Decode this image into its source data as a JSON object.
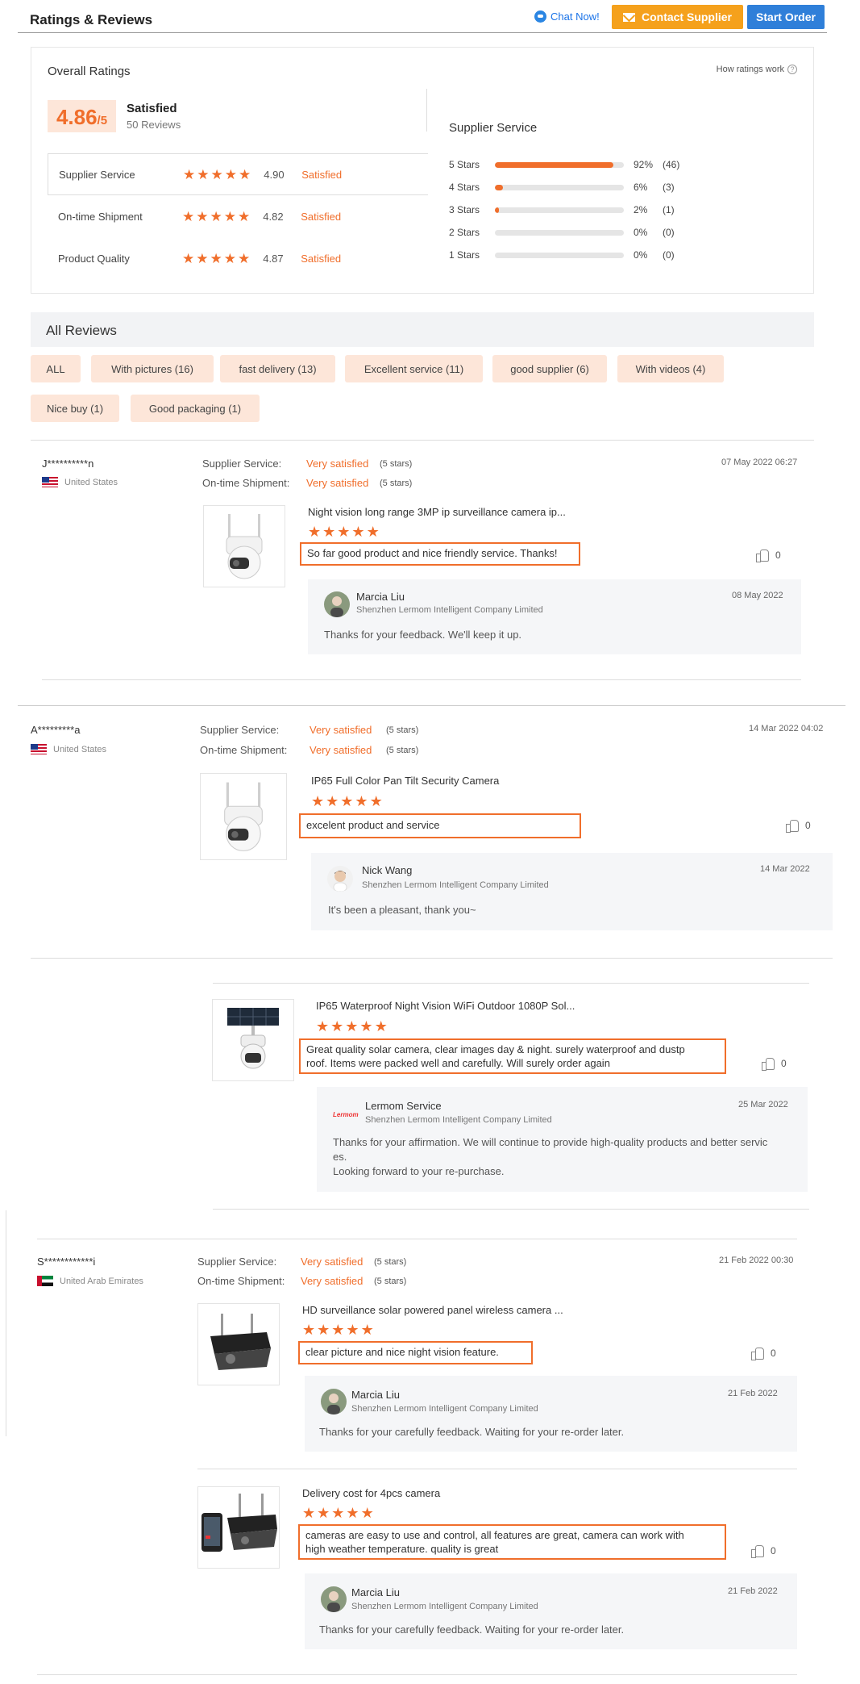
{
  "header": {
    "title": "Ratings & Reviews",
    "chat": "Chat Now!",
    "contact": "Contact Supplier",
    "start": "Start Order"
  },
  "overall": {
    "title": "Overall Ratings",
    "how": "How ratings work",
    "score": "4.86",
    "out_of": "/5",
    "label": "Satisfied",
    "count": "50 Reviews",
    "rows": [
      {
        "label": "Supplier Service",
        "value": "4.90",
        "status": "Satisfied",
        "stars": 5
      },
      {
        "label": "On-time Shipment",
        "value": "4.82",
        "status": "Satisfied",
        "stars": 5
      },
      {
        "label": "Product Quality",
        "value": "4.87",
        "status": "Satisfied",
        "stars": 5
      }
    ]
  },
  "breakdown": {
    "title": "Supplier Service",
    "rows": [
      {
        "label": "5 Stars",
        "percent": "92%",
        "count": "(46)",
        "fraction": 0.92
      },
      {
        "label": "4 Stars",
        "percent": "6%",
        "count": "(3)",
        "fraction": 0.06
      },
      {
        "label": "3 Stars",
        "percent": "2%",
        "count": "(1)",
        "fraction": 0.02
      },
      {
        "label": "2 Stars",
        "percent": "0%",
        "count": "(0)",
        "fraction": 0
      },
      {
        "label": "1 Stars",
        "percent": "0%",
        "count": "(0)",
        "fraction": 0
      }
    ]
  },
  "all_reviews": {
    "title": "All Reviews",
    "tags": [
      "ALL",
      "With pictures (16)",
      "fast delivery (13)",
      "Excellent service (11)",
      "good supplier (6)",
      "With videos (4)",
      "Nice buy (1)",
      "Good packaging (1)"
    ]
  },
  "labels": {
    "supplier_service": "Supplier Service:",
    "ontime": "On-time Shipment:",
    "very_satisfied": "Very satisfied",
    "five_stars": "(5 stars)"
  },
  "reviews": [
    {
      "user": "J**********n",
      "country": "United States",
      "date": "07 May 2022 06:27",
      "items": [
        {
          "product": "Night vision long range 3MP ip surveillance camera ip...",
          "comment": "So far good product and nice friendly service. Thanks!",
          "likes": "0",
          "reply": {
            "name": "Marcia Liu",
            "company": "Shenzhen Lermom Intelligent Company Limited",
            "date": "08 May 2022",
            "text": "Thanks for your feedback. We'll keep it up."
          }
        }
      ]
    },
    {
      "user": "A*********a",
      "country": "United States",
      "date": "14 Mar 2022 04:02",
      "items": [
        {
          "product": "IP65 Full Color Pan Tilt Security Camera",
          "comment": "excelent product and service",
          "likes": "0",
          "reply": {
            "name": "Nick Wang",
            "company": "Shenzhen Lermom Intelligent Company Limited",
            "date": "14 Mar 2022",
            "text": "It's been a pleasant, thank you~"
          }
        },
        {
          "product": "IP65 Waterproof Night Vision WiFi Outdoor 1080P Sol...",
          "comment_l1": "Great quality solar camera, clear images day & night. surely waterproof and dustp",
          "comment_l2": "roof. Items were packed well and carefully. Will surely order again",
          "likes": "0",
          "reply": {
            "name": "Lermom Service",
            "logo": "Lermom",
            "company": "Shenzhen Lermom Intelligent Company Limited",
            "date": "25 Mar 2022",
            "text_l1": "Thanks for your affirmation. We will continue to provide high-quality products and better servic",
            "text_l2": "es.",
            "text_l3": "Looking forward to your re-purchase."
          }
        }
      ]
    },
    {
      "user": "S************i",
      "country": "United Arab Emirates",
      "date": "21 Feb 2022 00:30",
      "items": [
        {
          "product": "HD surveillance solar powered panel wireless camera ...",
          "comment": "clear picture and nice night vision feature.",
          "likes": "0",
          "reply": {
            "name": "Marcia Liu",
            "company": "Shenzhen Lermom Intelligent Company Limited",
            "date": "21 Feb 2022",
            "text": "Thanks for your carefully feedback.  Waiting for your re-order later."
          }
        },
        {
          "product": "Delivery cost for 4pcs camera",
          "comment_l1": "cameras are easy to use and control, all features are great, camera can work with",
          "comment_l2": "high weather temperature. quality is great",
          "likes": "0",
          "reply": {
            "name": "Marcia Liu",
            "company": "Shenzhen Lermom Intelligent Company Limited",
            "date": "21 Feb 2022",
            "text": "Thanks for your carefully feedback.  Waiting for your re-order later."
          }
        }
      ]
    }
  ]
}
